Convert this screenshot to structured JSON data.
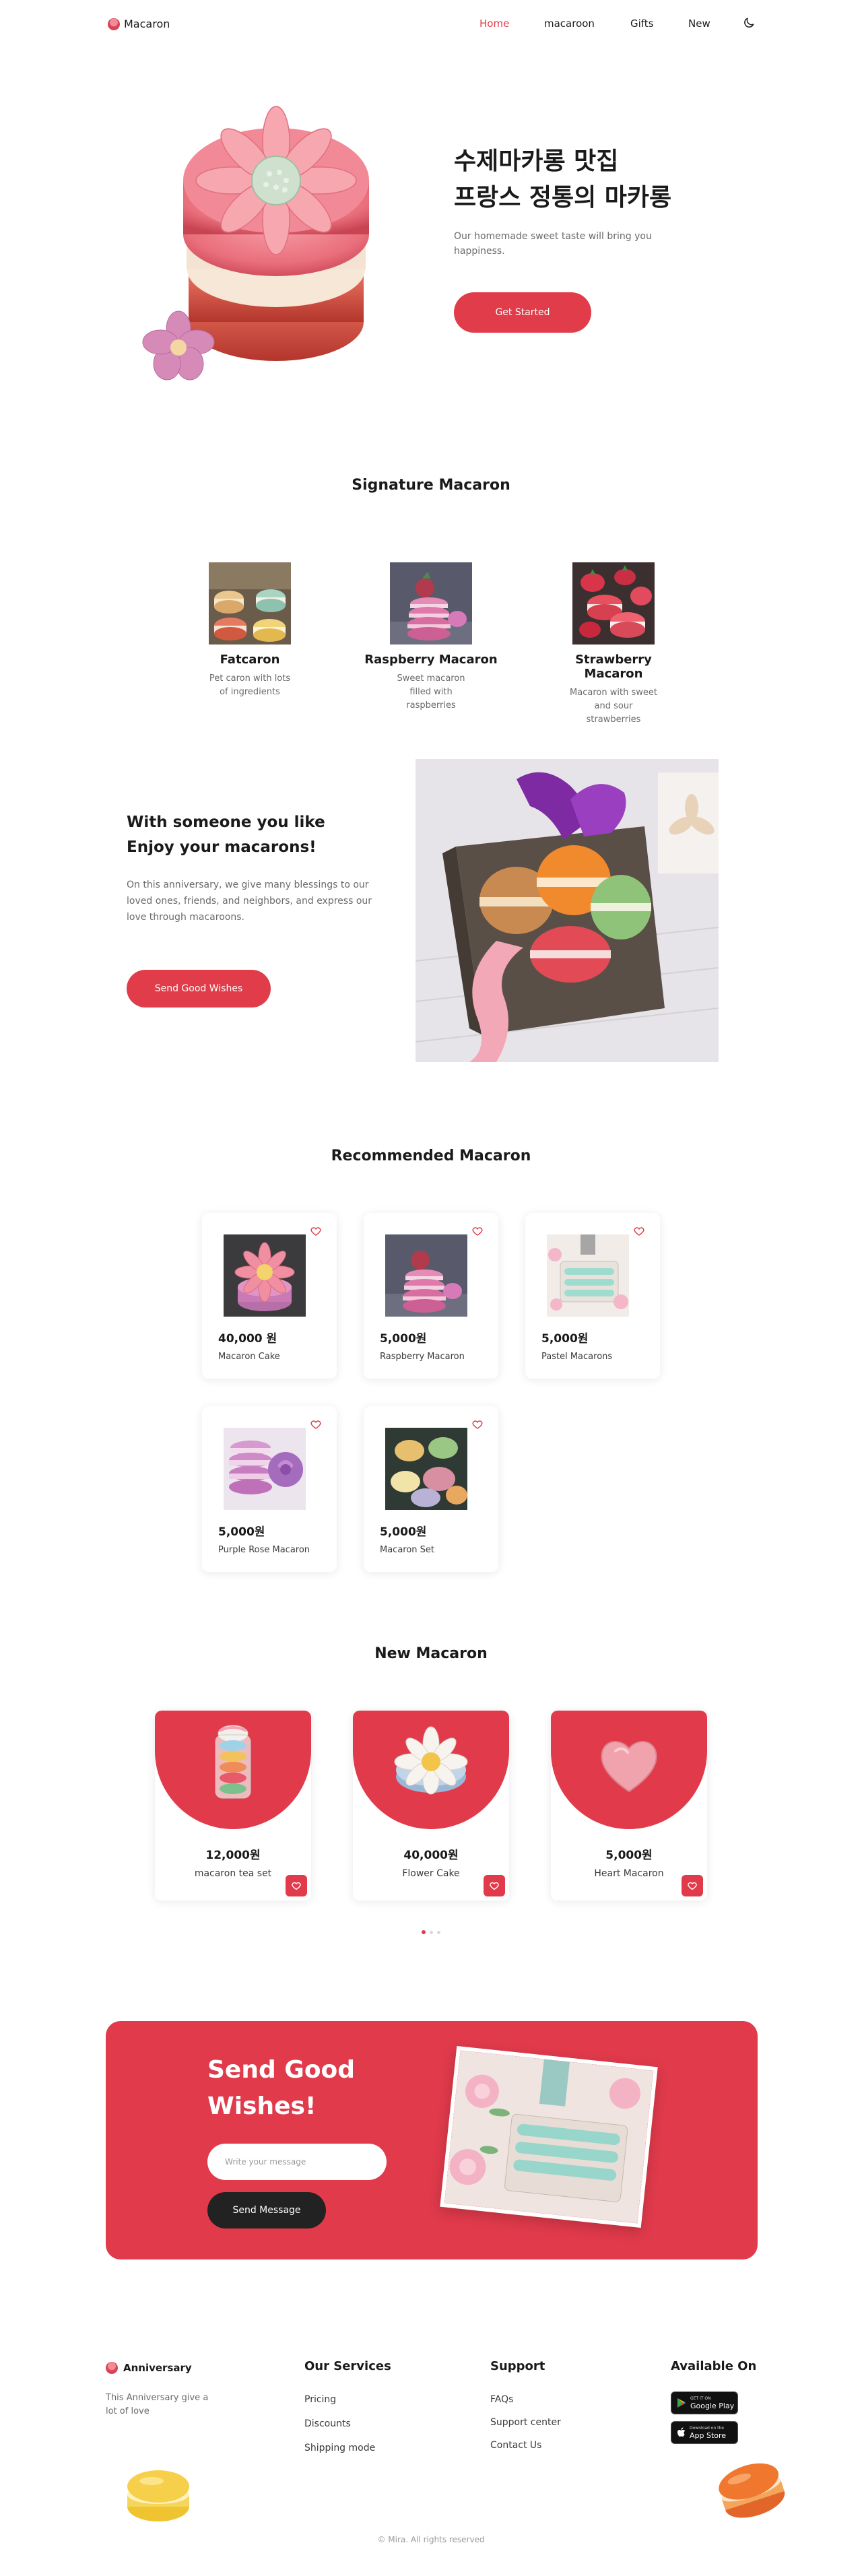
{
  "header": {
    "brand": "Macaron",
    "nav": [
      {
        "label": "Home",
        "active": true
      },
      {
        "label": "macaroon",
        "active": false
      },
      {
        "label": "Gifts",
        "active": false
      },
      {
        "label": "New",
        "active": false
      }
    ],
    "theme_toggle_icon": "moon-icon"
  },
  "hero": {
    "title_line1": "수제마카롱 맛집",
    "title_line2": "프랑스 정통의 마카롱",
    "description": "Our homemade sweet taste will bring you happiness.",
    "button": "Get Started"
  },
  "signature": {
    "title": "Signature Macaron",
    "items": [
      {
        "name": "Fatcaron",
        "description": "Pet caron with lots of ingredients"
      },
      {
        "name": "Raspberry Macaron",
        "description": "Sweet macaron filled with raspberries"
      },
      {
        "name": "Strawberry Macaron",
        "description": "Macaron with sweet and sour strawberries"
      }
    ]
  },
  "anniversary": {
    "title_line1": "With someone you like",
    "title_line2": "Enjoy your macarons!",
    "description": "On this anniversary, we give many blessings to our loved ones, friends, and neighbors, and express our love through macaroons.",
    "button": "Send Good Wishes"
  },
  "recommended": {
    "title": "Recommended Macaron",
    "items": [
      {
        "price": "40,000 원",
        "name": "Macaron Cake"
      },
      {
        "price": "5,000원",
        "name": "Raspberry Macaron"
      },
      {
        "price": "5,000원",
        "name": "Pastel Macarons"
      },
      {
        "price": "5,000원",
        "name": "Purple Rose Macaron"
      },
      {
        "price": "5,000원",
        "name": "Macaron Set"
      }
    ]
  },
  "new_macaron": {
    "title": "New Macaron",
    "items": [
      {
        "price": "12,000원",
        "name": "macaron tea set"
      },
      {
        "price": "40,000원",
        "name": "Flower Cake"
      },
      {
        "price": "5,000원",
        "name": "Heart Macaron"
      }
    ],
    "pagination_active": 1,
    "pagination_total": 3
  },
  "wishes": {
    "title_line1": "Send Good",
    "title_line2": "Wishes!",
    "input_placeholder": "Write your message",
    "button": "Send Message"
  },
  "footer": {
    "brand": "Anniversary",
    "tagline": "This Anniversary give a lot of love",
    "services": {
      "title": "Our Services",
      "links": [
        "Pricing",
        "Discounts",
        "Shipping mode"
      ]
    },
    "support": {
      "title": "Support",
      "links": [
        "FAQs",
        "Support center",
        "Contact Us"
      ]
    },
    "available": {
      "title": "Available On",
      "google_small": "GET IT ON",
      "google_big": "Google Play",
      "apple_small": "Download on the",
      "apple_big": "App Store"
    },
    "copyright": "© Mira. All rights reserved"
  },
  "colors": {
    "accent": "#e03c4a",
    "dark_button": "#222222",
    "text_muted": "#6a6a6a"
  }
}
